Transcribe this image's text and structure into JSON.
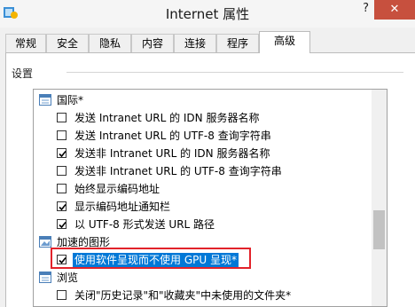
{
  "window": {
    "title": "Internet 属性",
    "help_label": "?",
    "close_label": "✕"
  },
  "tabs": [
    {
      "label": "常规"
    },
    {
      "label": "安全"
    },
    {
      "label": "隐私"
    },
    {
      "label": "内容"
    },
    {
      "label": "连接"
    },
    {
      "label": "程序"
    },
    {
      "label": "高级",
      "active": true
    }
  ],
  "settings": {
    "group_label": "设置",
    "items": [
      {
        "type": "category",
        "label": "国际*",
        "icon": "settings-category-icon"
      },
      {
        "type": "checkbox",
        "label": "发送 Intranet URL 的 IDN 服务器名称",
        "checked": false
      },
      {
        "type": "checkbox",
        "label": "发送 Intranet URL 的 UTF-8 查询字符串",
        "checked": false
      },
      {
        "type": "checkbox",
        "label": "发送非 Intranet URL 的 IDN 服务器名称",
        "checked": true
      },
      {
        "type": "checkbox",
        "label": "发送非 Intranet URL 的 UTF-8 查询字符串",
        "checked": false
      },
      {
        "type": "checkbox",
        "label": "始终显示编码地址",
        "checked": false
      },
      {
        "type": "checkbox",
        "label": "显示编码地址通知栏",
        "checked": true
      },
      {
        "type": "checkbox",
        "label": "以 UTF-8 形式发送 URL 路径",
        "checked": true
      },
      {
        "type": "category",
        "label": "加速的图形",
        "icon": "graphics-category-icon"
      },
      {
        "type": "checkbox",
        "label": "使用软件呈现而不使用 GPU 呈现*",
        "checked": true,
        "selected": true
      },
      {
        "type": "category",
        "label": "浏览",
        "icon": "settings-category-icon"
      },
      {
        "type": "checkbox",
        "label": "关闭\"历史记录\"和\"收藏夹\"中未使用的文件夹*",
        "checked": false
      }
    ]
  },
  "colors": {
    "selection_bg": "#0078d7",
    "highlight_border": "#e2222a",
    "close_button": "#c7503e"
  }
}
